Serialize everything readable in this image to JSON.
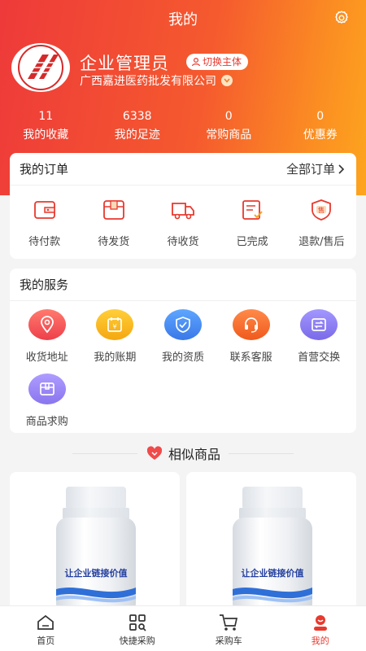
{
  "topbar": {
    "title": "我的"
  },
  "profile": {
    "name": "企业管理员",
    "switch_label": "切换主体",
    "company": "广西嘉进医药批发有限公司"
  },
  "stats": [
    {
      "value": "11",
      "label": "我的收藏"
    },
    {
      "value": "6338",
      "label": "我的足迹"
    },
    {
      "value": "0",
      "label": "常购商品"
    },
    {
      "value": "0",
      "label": "优惠券"
    }
  ],
  "orders": {
    "title": "我的订单",
    "all_label": "全部订单",
    "items": [
      {
        "label": "待付款",
        "icon": "wallet-icon"
      },
      {
        "label": "待发货",
        "icon": "package-icon"
      },
      {
        "label": "待收货",
        "icon": "truck-icon"
      },
      {
        "label": "已完成",
        "icon": "done-document-icon"
      },
      {
        "label": "退款/售后",
        "icon": "after-sale-shield-icon"
      }
    ]
  },
  "services": {
    "title": "我的服务",
    "items": [
      {
        "label": "收货地址",
        "icon": "location-icon",
        "color": "#f25a5a"
      },
      {
        "label": "我的账期",
        "icon": "calendar-yen-icon",
        "color": "#f7b81a"
      },
      {
        "label": "我的资质",
        "icon": "shield-check-icon",
        "color": "#4a8df0"
      },
      {
        "label": "联系客服",
        "icon": "headset-icon",
        "color": "#f5652a"
      },
      {
        "label": "首营交换",
        "icon": "exchange-icon",
        "color": "#8a7df0"
      },
      {
        "label": "商品求购",
        "icon": "box-icon",
        "color": "#9a86f2"
      }
    ]
  },
  "similar": {
    "title": "相似商品"
  },
  "products": [
    {
      "label_text": "让企业链接价值"
    },
    {
      "label_text": "让企业链接价值"
    }
  ],
  "tabbar": [
    {
      "label": "首页",
      "icon": "home-icon",
      "active": false
    },
    {
      "label": "快捷采购",
      "icon": "grid-search-icon",
      "active": false
    },
    {
      "label": "采购车",
      "icon": "cart-icon",
      "active": false
    },
    {
      "label": "我的",
      "icon": "user-icon",
      "active": true
    }
  ],
  "colors": {
    "accent": "#e8392e",
    "gradient_start": "#ee3a3a",
    "gradient_end": "#fda51e"
  }
}
